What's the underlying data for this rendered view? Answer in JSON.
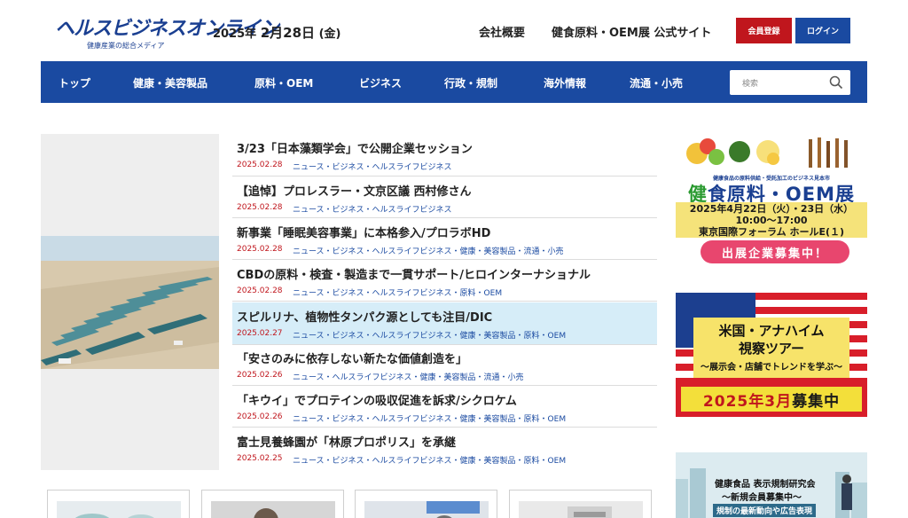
{
  "header": {
    "logo_main": "ヘルスビジネスオンライン",
    "logo_sub": "健康産業の総合メディア",
    "date_year": "2025年",
    "date_md": "2月28日",
    "date_dow": "(金)",
    "link_company": "会社概要",
    "link_expo": "健食原料・OEM展 公式サイト",
    "register_label": "会員登録",
    "login_label": "ログイン"
  },
  "nav": {
    "items": [
      "トップ",
      "健康・美容製品",
      "原料・OEM",
      "ビジネス",
      "行政・規制",
      "海外情報",
      "流通・小売"
    ],
    "search_placeholder": "検索"
  },
  "news": [
    {
      "title": "3/23「日本藻類学会」で公開企業セッション",
      "date": "2025.02.28",
      "cats": "ニュース・ビジネス・ヘルスライフビジネス"
    },
    {
      "title": "【追悼】プロレスラー・文京区議 西村修さん",
      "date": "2025.02.28",
      "cats": "ニュース・ビジネス・ヘルスライフビジネス"
    },
    {
      "title": "新事業「睡眠美容事業」に本格参入/プロラボHD",
      "date": "2025.02.28",
      "cats": "ニュース・ビジネス・ヘルスライフビジネス・健康・美容製品・流通・小売"
    },
    {
      "title": "CBDの原料・検査・製造まで一貫サポート/ヒロインターナショナル",
      "date": "2025.02.28",
      "cats": "ニュース・ビジネス・ヘルスライフビジネス・原料・OEM"
    },
    {
      "title": "スピルリナ、植物性タンパク源としても注目/DIC",
      "date": "2025.02.27",
      "cats": "ニュース・ビジネス・ヘルスライフビジネス・健康・美容製品・原料・OEM"
    },
    {
      "title": "「安さのみに依存しない新たな価値創造を」",
      "date": "2025.02.26",
      "cats": "ニュース・ヘルスライフビジネス・健康・美容製品・流通・小売"
    },
    {
      "title": "「キウイ」でプロテインの吸収促進を訴求/シクロケム",
      "date": "2025.02.26",
      "cats": "ニュース・ビジネス・ヘルスライフビジネス・健康・美容製品・原料・OEM"
    },
    {
      "title": "富士見養蜂園が「林原プロポリス」を承継",
      "date": "2025.02.25",
      "cats": "ニュース・ビジネス・ヘルスライフビジネス・健康・美容製品・原料・OEM"
    }
  ],
  "banner_expo": {
    "sub": "健康食品の原料供給・受託加工のビジネス見本市",
    "title_a": "健",
    "title_b": "食原料・OEM展",
    "line1": "2025年4月22日（火）・23日（水）",
    "line2": "10:00～17:00",
    "line3": "東京国際フォーラム ホールE(１)",
    "cta": "出展企業募集中！"
  },
  "banner_tour": {
    "line1": "米国・アナハイム",
    "line2": "視察ツアー",
    "line3": "～展示会・店舗でトレンドを学ぶ～",
    "rec_a": "2025年3月",
    "rec_b": "募集中"
  },
  "banner_study": {
    "line1": "健康食品 表示規制研究会",
    "line2": "～新規会員募集中～",
    "line3": "規制の最新動向や広告表現"
  },
  "colors": {
    "brand_blue": "#1a4aa1",
    "accent_red": "#c0161d",
    "highlight": "#d6edf8"
  }
}
